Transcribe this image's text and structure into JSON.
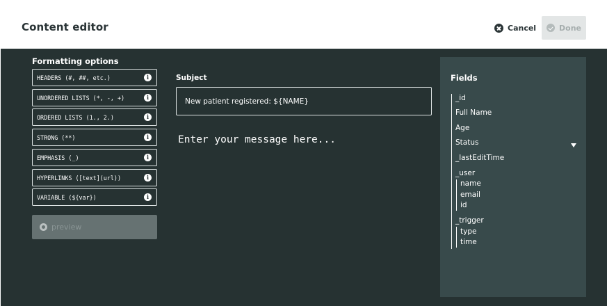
{
  "header": {
    "title": "Content editor",
    "cancel_label": "Cancel",
    "done_label": "Done"
  },
  "formatting": {
    "title": "Formatting options",
    "items": [
      {
        "label": "HEADERS (#, ##, etc.)",
        "icon": "info-icon"
      },
      {
        "label": "UNORDERED LISTS (*, -, +)",
        "icon": "info-icon"
      },
      {
        "label": "ORDERED LISTS (1., 2.)",
        "icon": "info-icon"
      },
      {
        "label": "STRONG (**)",
        "icon": "info-icon"
      },
      {
        "label": "EMPHASIS (_)",
        "icon": "info-icon"
      },
      {
        "label": "HYPERLINKS ([text](url))",
        "icon": "info-icon"
      },
      {
        "label": "VARIABLE (${var})",
        "icon": "info-icon"
      }
    ],
    "info_glyph": "i",
    "preview_label": "preview"
  },
  "editor": {
    "subject_label": "Subject",
    "subject_value": "New patient registered: ${NAME}",
    "message_placeholder": "Enter your message here..."
  },
  "fields": {
    "title": "Fields",
    "items": [
      "_id",
      "Full Name",
      "Age",
      "Status",
      "_lastEditTime",
      "_user",
      "name",
      "email",
      "id",
      "_trigger",
      "type",
      "time"
    ]
  },
  "colors": {
    "background": "#263232",
    "fields_panel": "#384a4b",
    "preview_button": "#667272",
    "done_button": "#e3e6e6",
    "text_dark": "#2a3436"
  }
}
